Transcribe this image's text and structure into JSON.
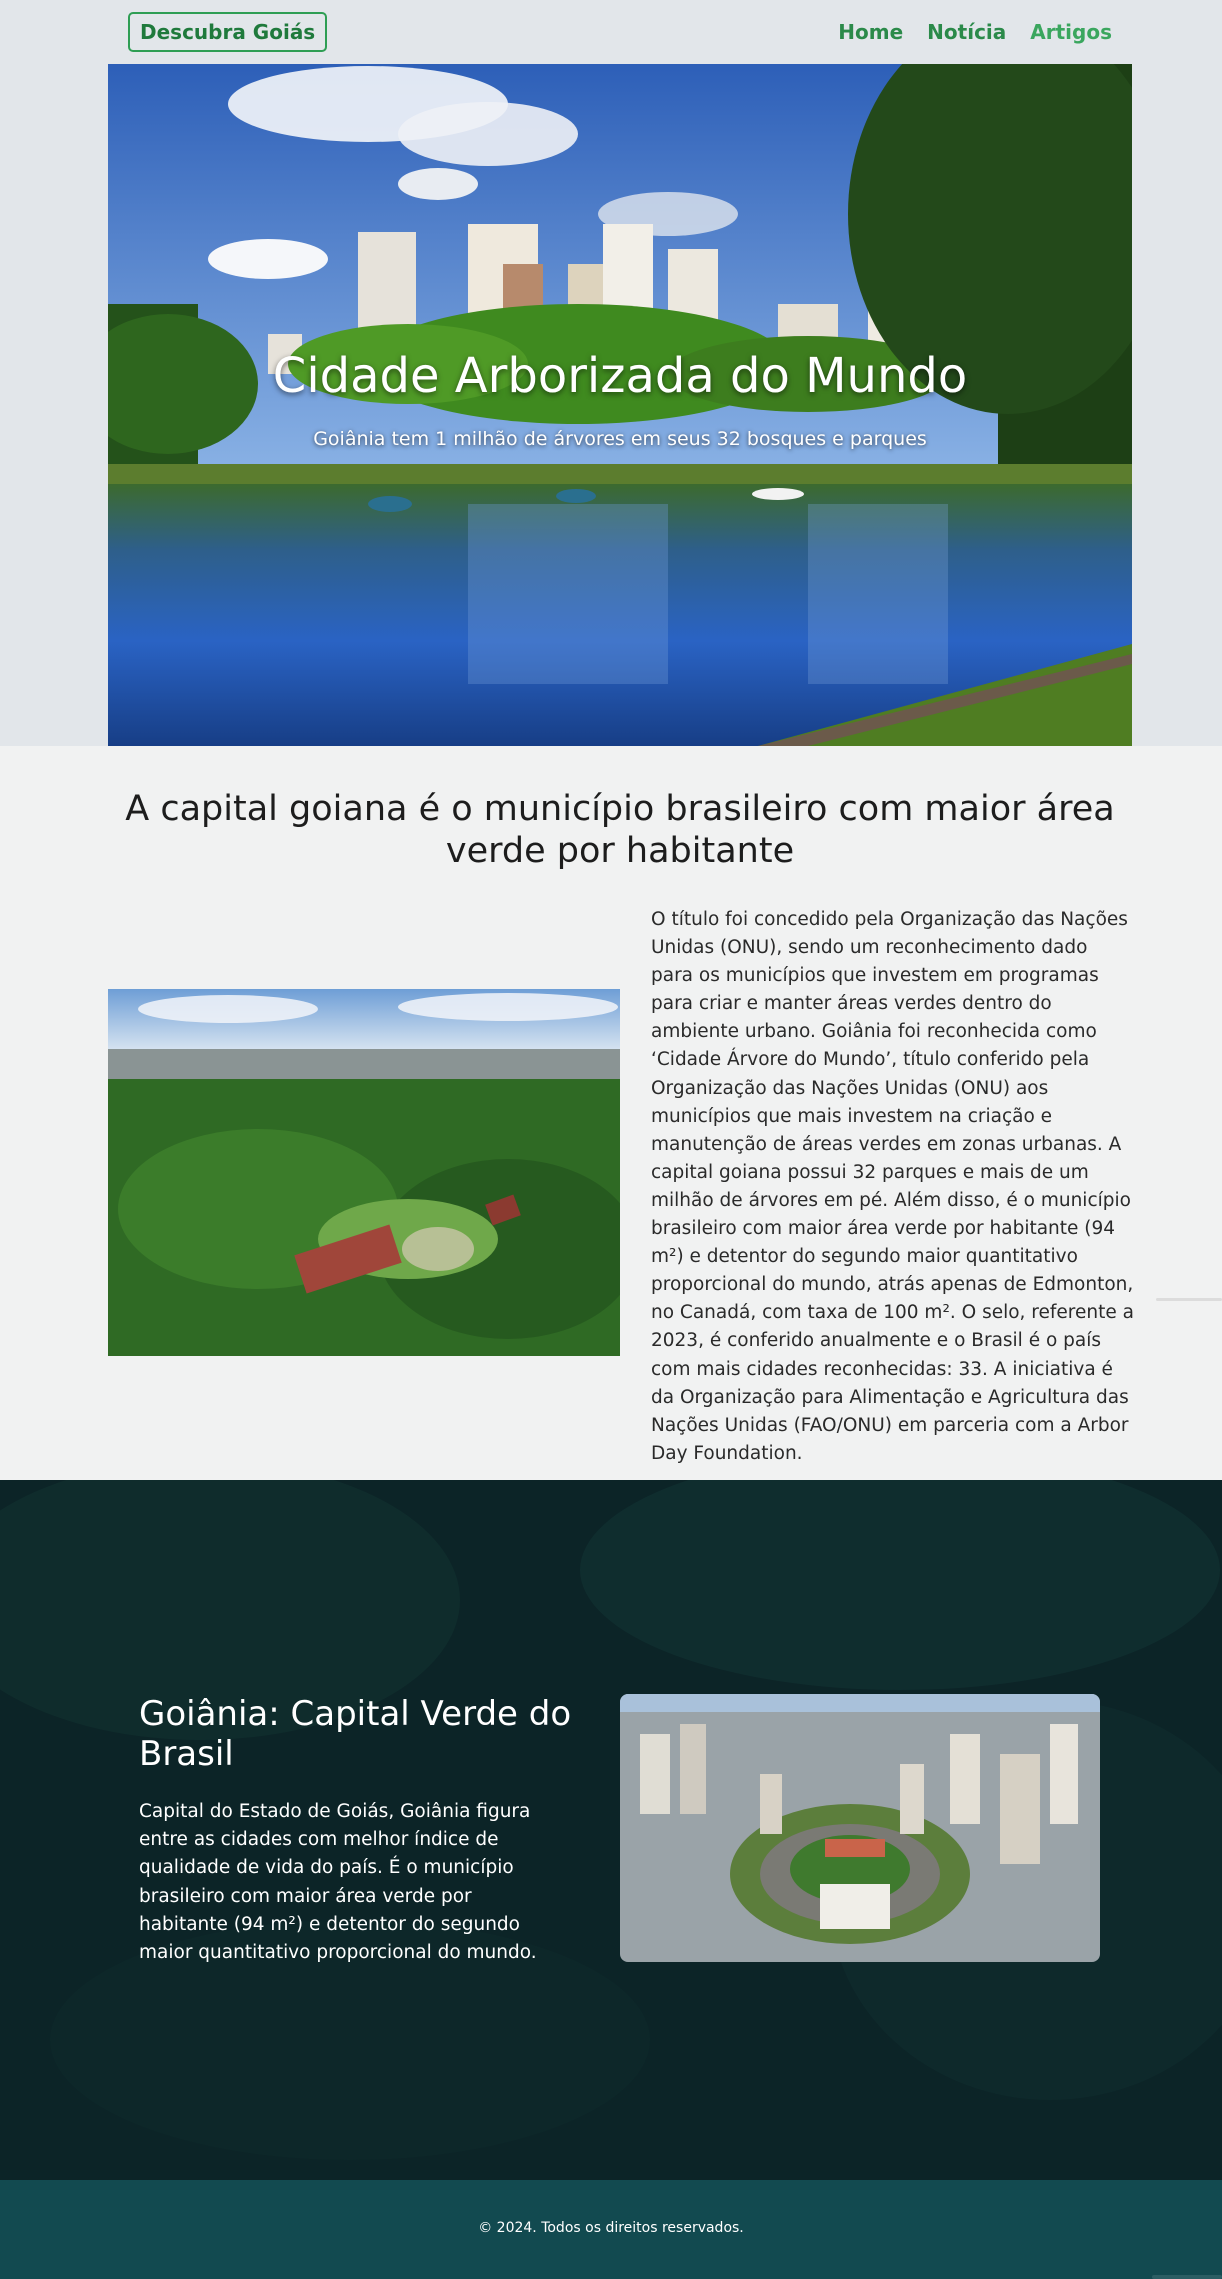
{
  "nav": {
    "brand": "Descubra Goiás",
    "links": [
      "Home",
      "Notícia",
      "Artigos"
    ]
  },
  "hero": {
    "title": "Cidade Arborizada do Mundo",
    "subtitle": "Goiânia tem 1 milhão de árvores em seus 32 bosques e parques"
  },
  "article": {
    "heading": "A capital goiana é o município brasileiro com maior área verde por habitante",
    "body": "O título foi concedido pela Organização das Nações Unidas (ONU), sendo um reconhecimento dado para os municípios que investem em programas para criar e manter áreas verdes dentro do ambiente urbano. Goiânia foi reconhecida como ‘Cidade Árvore do Mundo’, título conferido pela Organização das Nações Unidas (ONU) aos municípios que mais investem na criação e manutenção de áreas verdes em zonas urbanas. A capital goiana possui 32 parques e mais de um milhão de árvores em pé. Além disso, é o município brasileiro com maior área verde por habitante (94 m²) e detentor do segundo maior quantitativo proporcional do mundo, atrás apenas de Edmonton, no Canadá, com taxa de 100 m². O selo, referente a 2023, é conferido anualmente e o Brasil é o país com mais cidades reconhecidas: 33. A iniciativa é da Organização para Alimentação e Agricultura das Nações Unidas (FAO/ONU) em parceria com a Arbor Day Foundation."
  },
  "feature": {
    "heading": "Goiânia: Capital Verde do Brasil",
    "body": "Capital do Estado de Goiás, Goiânia figura entre as cidades com melhor índice de qualidade de vida do país. É o município brasileiro com maior área verde por habitante (94 m²) e detentor do segundo maior quantitativo proporcional do mundo."
  },
  "footer": {
    "copyright": "© 2024. Todos os direitos reservados."
  },
  "colors": {
    "brand_green": "#2e9e54",
    "nav_link": "#2b8a4a",
    "feature_bg": "#0c2427",
    "footer_bg": "#124a50"
  }
}
